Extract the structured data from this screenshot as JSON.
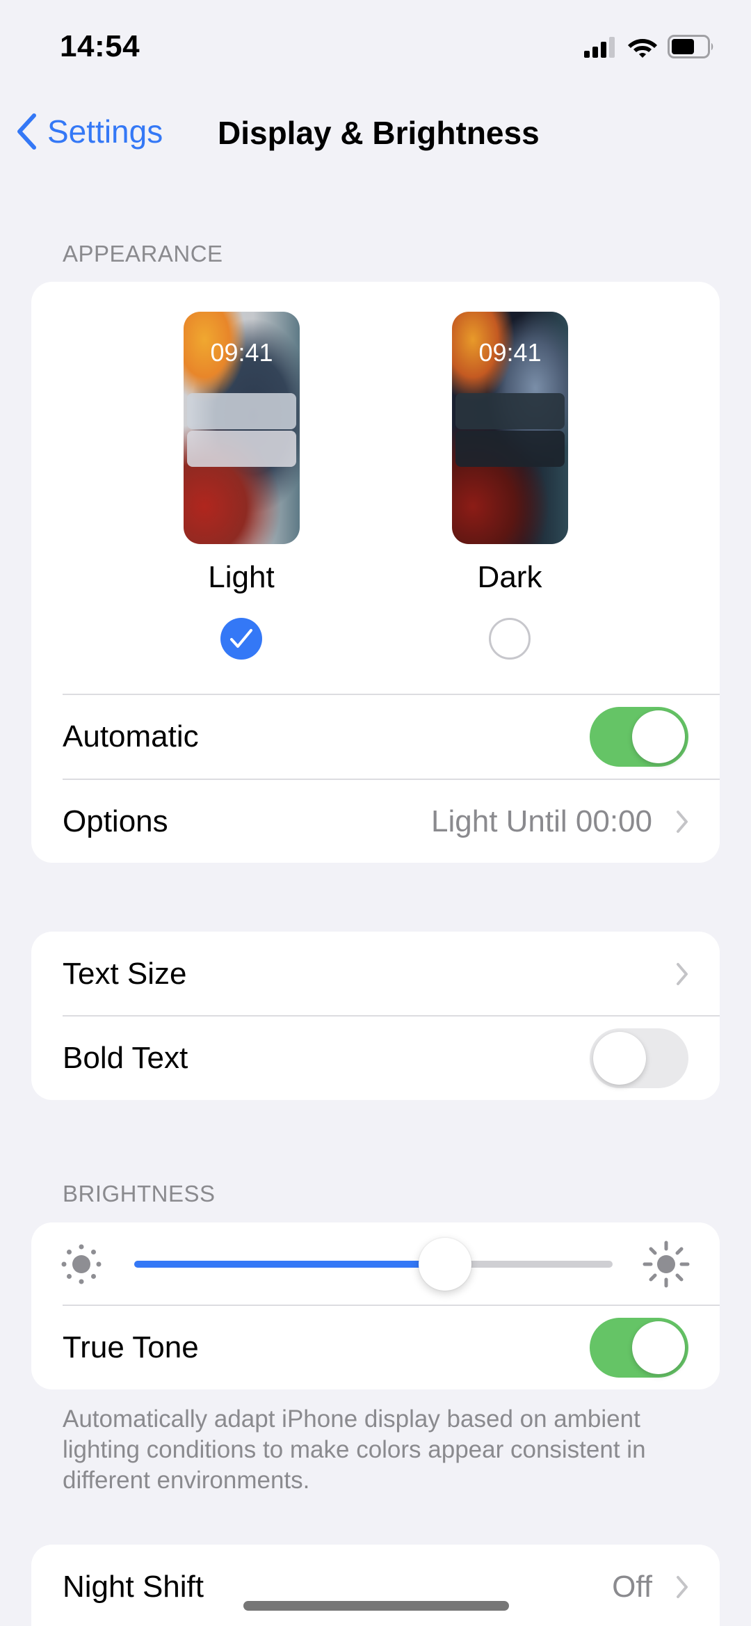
{
  "status_bar": {
    "time": "14:54",
    "icons": [
      "cellular-signal-icon",
      "wifi-icon",
      "battery-icon"
    ]
  },
  "nav": {
    "back_label": "Settings",
    "back_icon": "chevron-left-icon",
    "title": "Display & Brightness"
  },
  "appearance": {
    "header": "APPEARANCE",
    "options": [
      {
        "label": "Light",
        "preview_time": "09:41",
        "selected": true
      },
      {
        "label": "Dark",
        "preview_time": "09:41",
        "selected": false
      }
    ],
    "automatic": {
      "label": "Automatic",
      "on": true
    },
    "options_row": {
      "label": "Options",
      "value": "Light Until 00:00"
    }
  },
  "text": {
    "text_size": {
      "label": "Text Size"
    },
    "bold_text": {
      "label": "Bold Text",
      "on": false
    }
  },
  "brightness": {
    "header": "BRIGHTNESS",
    "level": 0.65,
    "min_icon": "sun-min-icon",
    "max_icon": "sun-max-icon",
    "true_tone": {
      "label": "True Tone",
      "on": true
    },
    "footer": "Automatically adapt iPhone display based on ambient lighting conditions to make colors appear consistent in different environments."
  },
  "night_shift": {
    "label": "Night Shift",
    "value": "Off"
  },
  "colors": {
    "accent": "#3478f6",
    "toggle_on": "#65c466",
    "toggle_off": "#e9e9eb",
    "background": "#f2f2f7",
    "secondary_text": "#8a8a8e"
  }
}
